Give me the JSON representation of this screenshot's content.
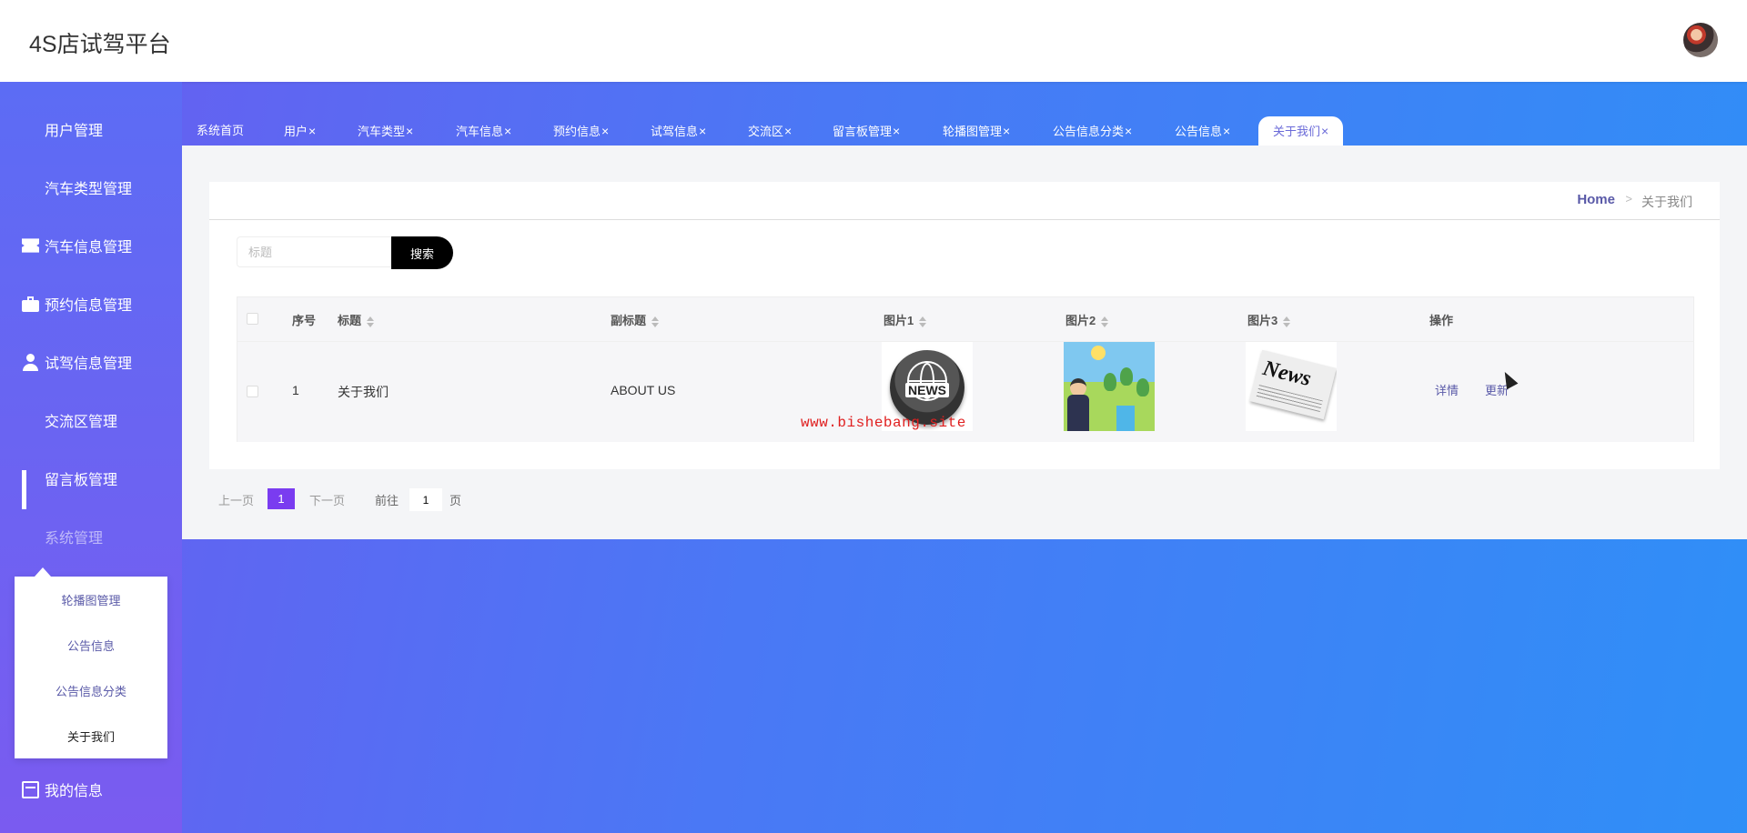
{
  "app": {
    "title": "4S店试驾平台"
  },
  "sidebar": {
    "items": [
      {
        "label": "用户管理",
        "icon": "grid-icon"
      },
      {
        "label": "汽车类型管理",
        "icon": "grid-icon"
      },
      {
        "label": "汽车信息管理",
        "icon": "ticket-icon"
      },
      {
        "label": "预约信息管理",
        "icon": "briefcase-icon"
      },
      {
        "label": "试驾信息管理",
        "icon": "user-icon"
      },
      {
        "label": "交流区管理",
        "icon": "grid-icon"
      },
      {
        "label": "留言板管理",
        "icon": "bar-chart-icon"
      },
      {
        "label": "系统管理",
        "icon": "grid-icon"
      },
      {
        "label": "我的信息",
        "icon": "card-icon"
      }
    ],
    "submenu": [
      "轮播图管理",
      "公告信息",
      "公告信息分类",
      "关于我们"
    ]
  },
  "tabs": [
    {
      "label": "系统首页",
      "closable": false
    },
    {
      "label": "用户",
      "closable": true
    },
    {
      "label": "汽车类型",
      "closable": true
    },
    {
      "label": "汽车信息",
      "closable": true
    },
    {
      "label": "预约信息",
      "closable": true
    },
    {
      "label": "试驾信息",
      "closable": true
    },
    {
      "label": "交流区",
      "closable": true
    },
    {
      "label": "留言板管理",
      "closable": true
    },
    {
      "label": "轮播图管理",
      "closable": true
    },
    {
      "label": "公告信息分类",
      "closable": true
    },
    {
      "label": "公告信息",
      "closable": true
    },
    {
      "label": "关于我们",
      "closable": true,
      "active": true
    }
  ],
  "close_glyph": "×",
  "breadcrumb": {
    "home": "Home",
    "separator": ">",
    "current": "关于我们"
  },
  "search": {
    "placeholder": "标题",
    "button": "搜索"
  },
  "table": {
    "headers": {
      "index": "序号",
      "title": "标题",
      "subtitle": "副标题",
      "img1": "图片1",
      "img2": "图片2",
      "img3": "图片3",
      "actions": "操作"
    },
    "rows": [
      {
        "index": "1",
        "title": "关于我们",
        "subtitle": "ABOUT US",
        "img1_text": "NEWS",
        "img3_text": "News",
        "detail": "详情",
        "update": "更新"
      }
    ]
  },
  "watermark": "www.bishebang.site",
  "pagination": {
    "prev": "上一页",
    "current": "1",
    "next": "下一页",
    "goto": "前往",
    "page_value": "1",
    "page_unit": "页"
  },
  "colors": {
    "accent": "#7a3cf0",
    "link": "#5a5aa8",
    "search_button": "#000000"
  }
}
